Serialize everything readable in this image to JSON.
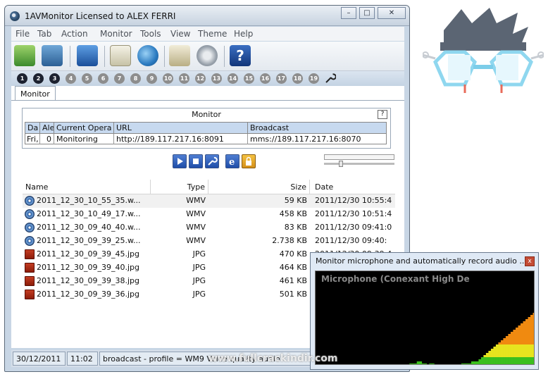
{
  "window": {
    "title": "1AVMonitor Licensed to ALEX FERRI",
    "minimize": "–",
    "maximize": "□",
    "close": "✕"
  },
  "menu": [
    "File",
    "Tab",
    "Action",
    "Monitor",
    "Tools",
    "View",
    "Theme",
    "Help"
  ],
  "toolbar_icons": [
    "monitor-tray-icon",
    "video-settings-icon",
    "screens-icon",
    "mail-icon",
    "web-publish-icon",
    "book-icon",
    "gears-icon",
    "help-icon"
  ],
  "tab_numbers": [
    "1",
    "2",
    "3",
    "4",
    "5",
    "6",
    "7",
    "8",
    "9",
    "10",
    "11",
    "12",
    "13",
    "14",
    "15",
    "16",
    "17",
    "18",
    "19"
  ],
  "active_tabs": 3,
  "tab": {
    "label": "Monitor"
  },
  "monitor_group": {
    "title": "Monitor",
    "help": "?",
    "headers": [
      "Da",
      "Ale",
      "Current Opera",
      "URL",
      "Broadcast"
    ],
    "row": [
      "Fri,",
      "0",
      "Monitoring",
      "http://189.117.217.16:8091",
      "mms://189.117.217.16:8070"
    ]
  },
  "file_list": {
    "headers": [
      "Name",
      "Type",
      "Size",
      "Date"
    ],
    "rows": [
      {
        "name": "2011_12_30_10_55_35.w...",
        "type": "WMV",
        "size": "59 KB",
        "date": "2011/12/30 10:55:4",
        "kind": "wmv"
      },
      {
        "name": "2011_12_30_10_49_17.w...",
        "type": "WMV",
        "size": "458 KB",
        "date": "2011/12/30 10:51:4",
        "kind": "wmv"
      },
      {
        "name": "2011_12_30_09_40_40.w...",
        "type": "WMV",
        "size": "83 KB",
        "date": "2011/12/30 09:41:0",
        "kind": "wmv"
      },
      {
        "name": "2011_12_30_09_39_25.w...",
        "type": "WMV",
        "size": "2.738 KB",
        "date": "2011/12/30 09:40:",
        "kind": "wmv"
      },
      {
        "name": "2011_12_30_09_39_45.jpg",
        "type": "JPG",
        "size": "470 KB",
        "date": "2011/12/30 09:39:4",
        "kind": "jpg"
      },
      {
        "name": "2011_12_30_09_39_40.jpg",
        "type": "JPG",
        "size": "464 KB",
        "date": "",
        "kind": "jpg"
      },
      {
        "name": "2011_12_30_09_39_38.jpg",
        "type": "JPG",
        "size": "461 KB",
        "date": "",
        "kind": "jpg"
      },
      {
        "name": "2011_12_30_09_39_36.jpg",
        "type": "JPG",
        "size": "501 KB",
        "date": "",
        "kind": "jpg"
      }
    ]
  },
  "status": {
    "date": "30/12/2011",
    "time": "11:02",
    "message": "broadcast - profile = WM9 Voice quality audio"
  },
  "popup": {
    "title": "Monitor microphone and automatically record audio ...",
    "close": "x",
    "device": "Microphone (Conexant High De",
    "levels": [
      0,
      0,
      0,
      0,
      0,
      0,
      0,
      0,
      0,
      0,
      0,
      0,
      0,
      0,
      0,
      0,
      0,
      0,
      0,
      0,
      0,
      0,
      0,
      0,
      0,
      0,
      0,
      0,
      0,
      0,
      0,
      0,
      0,
      0,
      0,
      0,
      0,
      0,
      1,
      1,
      1,
      2,
      2,
      1,
      1,
      0,
      1,
      1,
      0,
      0,
      0,
      0,
      0,
      0,
      0,
      0,
      0,
      0,
      0,
      1,
      1,
      1,
      1,
      2,
      2,
      2,
      3,
      4,
      5,
      6,
      7,
      8,
      9,
      10,
      11,
      12,
      13,
      14,
      15,
      16,
      17,
      18,
      19,
      20,
      21,
      22,
      23,
      24,
      25
    ],
    "colors": {
      "low": "#3bbf1e",
      "mid": "#e7e41f",
      "high": "#f08a10"
    }
  },
  "watermark": "www.fullcrackindir.com",
  "accent": "#4a7ab5"
}
